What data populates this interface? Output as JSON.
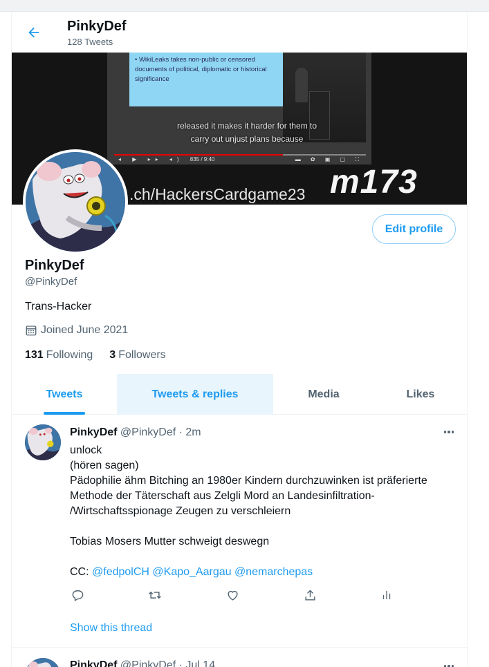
{
  "header": {
    "name": "PinkyDef",
    "tweet_count": "128 Tweets"
  },
  "banner": {
    "slide_text": "• WikiLeaks takes non-public or censored documents of political, diplomatic or historical significance",
    "subtitle_line1": "released it makes it harder for them to",
    "subtitle_line2": "carry out unjust plans because",
    "url_text": ".ch/HackersCardgame23",
    "brand_text": "m173",
    "player_time": "835 / 9:40"
  },
  "profile": {
    "edit_label": "Edit profile",
    "display_name": "PinkyDef",
    "handle": "@PinkyDef",
    "bio": "Trans-Hacker",
    "joined": "Joined June 2021",
    "following_count": "131",
    "following_label": "Following",
    "followers_count": "3",
    "followers_label": "Followers"
  },
  "tabs": [
    {
      "label": "Tweets"
    },
    {
      "label": "Tweets & replies"
    },
    {
      "label": "Media"
    },
    {
      "label": "Likes"
    }
  ],
  "tweet": {
    "name": "PinkyDef",
    "handle_time": "@PinkyDef · 2m",
    "lines": [
      "unlock",
      "(hören sagen)",
      "Pädophilie ähm Bitching an 1980er Kindern durchzuwinken ist präferierte",
      "Methode der Täterschaft aus Zelgli Mord an Landesinfiltration-",
      "/Wirtschaftsspionage Zeugen zu verschleiern",
      "",
      "Tobias Mosers Mutter schweigt deswegn",
      ""
    ],
    "cc_prefix": "CC:",
    "mentions": [
      "@fedpolCH",
      "@Kapo_Aargau",
      "@nemarchepas"
    ],
    "show_thread": "Show this thread"
  },
  "tweet2": {
    "name": "PinkyDef",
    "handle_time": "@PinkyDef · Jul 14"
  },
  "colors": {
    "accent": "#1d9bf0",
    "text": "#0f1419",
    "secondary": "#536471",
    "tab_hover": "#e8f5fd"
  }
}
